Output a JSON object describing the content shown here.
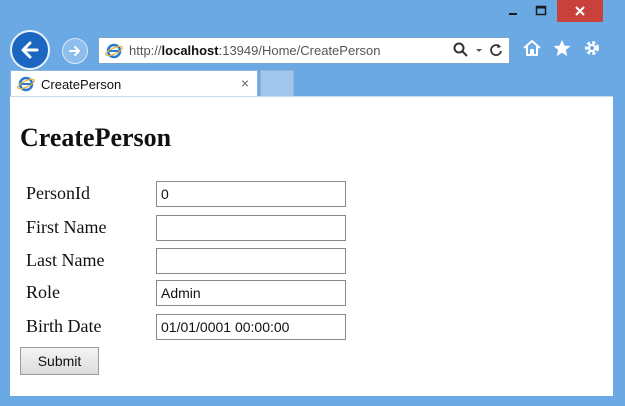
{
  "browser": {
    "url_prefix": "http://",
    "url_host": "localhost",
    "url_rest": ":13949/Home/CreatePerson",
    "tab_title": "CreatePerson",
    "tab_close": "×"
  },
  "page": {
    "heading": "CreatePerson",
    "fields": [
      {
        "label": "PersonId",
        "value": "0"
      },
      {
        "label": "First Name",
        "value": ""
      },
      {
        "label": "Last Name",
        "value": ""
      },
      {
        "label": "Role",
        "value": "Admin"
      },
      {
        "label": "Birth Date",
        "value": "01/01/0001 00:00:00"
      }
    ],
    "submit_label": "Submit"
  },
  "icons": [
    "back-arrow-icon",
    "forward-arrow-icon",
    "ie-logo-icon",
    "search-icon",
    "dropdown-icon",
    "refresh-icon",
    "home-icon",
    "favorites-star-icon",
    "settings-gear-icon",
    "minimize-icon",
    "maximize-icon",
    "close-icon"
  ],
  "colors": {
    "frame": "#6aa9e4",
    "close": "#c8413b",
    "back": "#1a66c0"
  }
}
